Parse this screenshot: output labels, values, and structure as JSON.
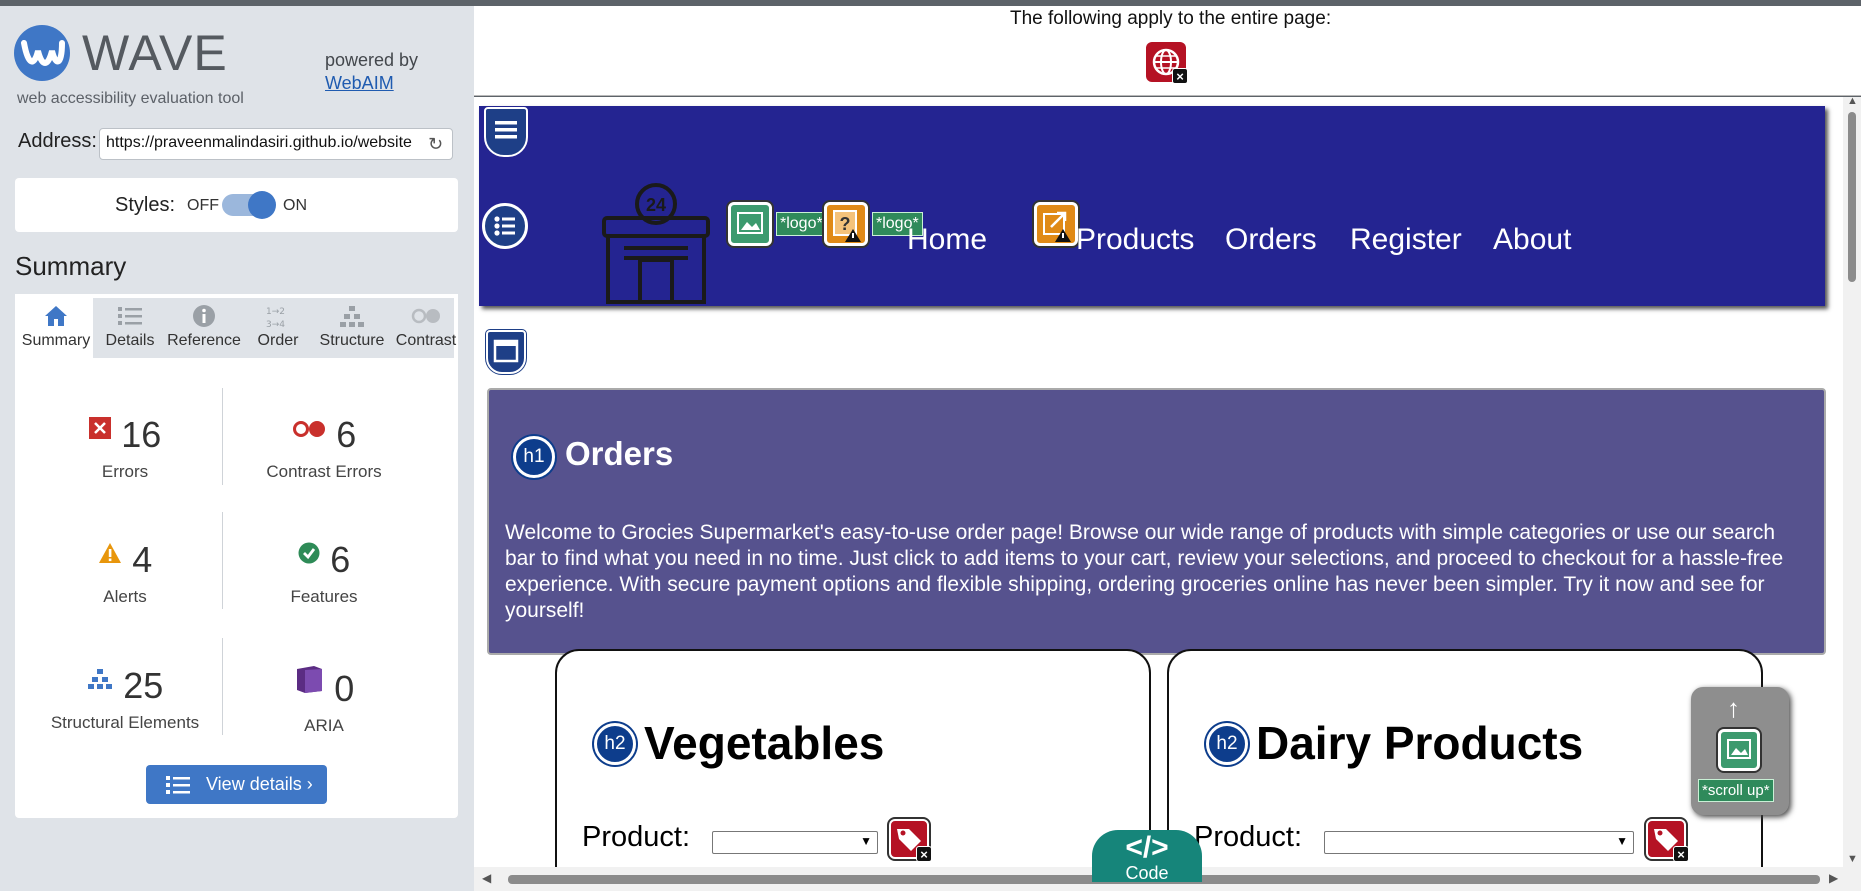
{
  "wave": {
    "logo_text": "WAVE",
    "tagline": "web accessibility evaluation tool",
    "powered_by": "powered by",
    "webaim_link": "WebAIM",
    "address_label": "Address:",
    "address_value": "https://praveenmalindasiri.github.io/website",
    "styles_label": "Styles:",
    "styles_off": "OFF",
    "styles_on": "ON",
    "styles_state": "on",
    "summary_title": "Summary",
    "tabs": [
      {
        "label": "Summary",
        "icon": "home-icon",
        "active": true
      },
      {
        "label": "Details",
        "icon": "list-icon",
        "active": false
      },
      {
        "label": "Reference",
        "icon": "info-icon",
        "active": false
      },
      {
        "label": "Order",
        "icon": "order-icon",
        "active": false
      },
      {
        "label": "Structure",
        "icon": "structure-icon",
        "active": false
      },
      {
        "label": "Contrast",
        "icon": "contrast-icon",
        "active": false
      }
    ],
    "stats": [
      {
        "count": "16",
        "label": "Errors",
        "icon": "error-icon",
        "color": "#c9302c"
      },
      {
        "count": "6",
        "label": "Contrast Errors",
        "icon": "contrast-error-icon",
        "color": "#c9302c"
      },
      {
        "count": "4",
        "label": "Alerts",
        "icon": "alert-icon",
        "color": "#e8960c"
      },
      {
        "count": "6",
        "label": "Features",
        "icon": "feature-icon",
        "color": "#2e8b57"
      },
      {
        "count": "25",
        "label": "Structural Elements",
        "icon": "structure-icon",
        "color": "#3f77c6"
      },
      {
        "count": "0",
        "label": "ARIA",
        "icon": "aria-icon",
        "color": "#5b2c83"
      }
    ],
    "view_details": "View details ›"
  },
  "apply_bar": {
    "text": "The following apply to the entire page:"
  },
  "site": {
    "nav": [
      "Home",
      "Products",
      "Orders",
      "Register",
      "About"
    ],
    "logo_alt": "*logo*",
    "h1_badge": "h1",
    "h1": "Orders",
    "intro": "Welcome to Grocies Supermarket's easy-to-use order page! Browse our wide range of products with simple categories or use our search bar to find what you need in no time. Just click to add items to your cart, review your selections, and proceed to checkout for a hassle-free experience. With secure payment options and flexible shipping, ordering groceries online has never been simpler. Try it now and see for yourself!",
    "h2_badge": "h2",
    "sections": [
      {
        "title": "Vegetables",
        "product_label": "Product:"
      },
      {
        "title": "Dairy Products",
        "product_label": "Product:"
      }
    ],
    "scroll_up_alt": "*scroll up*",
    "store_number": "24"
  },
  "code_tab": {
    "glyph": "</>",
    "label": "Code"
  },
  "colors": {
    "wave_blue": "#3f77c6",
    "navbar": "#242491",
    "intro_bg": "#56528e",
    "error_red": "#b51224",
    "alert_orange": "#e8960c",
    "feature_green": "#3c9a6e",
    "code_teal": "#16857a"
  }
}
